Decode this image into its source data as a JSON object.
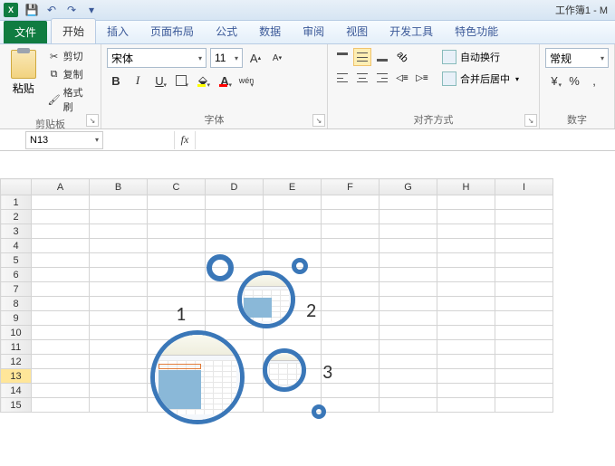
{
  "app": {
    "title": "工作簿1 - M",
    "excel_badge": "X"
  },
  "qat": {
    "save": "💾",
    "undo": "↶",
    "redo": "↷"
  },
  "tabs": {
    "file": "文件",
    "items": [
      "开始",
      "插入",
      "页面布局",
      "公式",
      "数据",
      "审阅",
      "视图",
      "开发工具",
      "特色功能"
    ],
    "active": 0
  },
  "ribbon": {
    "clipboard": {
      "label": "剪贴板",
      "paste": "粘贴",
      "cut": "剪切",
      "copy": "复制",
      "format_painter": "格式刷"
    },
    "font": {
      "label": "字体",
      "name": "宋体",
      "size": "11",
      "bold": "B",
      "italic": "I",
      "underline": "U",
      "grow": "A",
      "shrink": "A",
      "wen": "wén"
    },
    "alignment": {
      "label": "对齐方式",
      "wrap": "自动换行",
      "merge": "合并后居中"
    },
    "number": {
      "label": "数字",
      "format": "常规",
      "percent": "%",
      "comma": ","
    }
  },
  "namebox": "N13",
  "columns": [
    "A",
    "B",
    "C",
    "D",
    "E",
    "F",
    "G",
    "H",
    "I"
  ],
  "rows": [
    "1",
    "2",
    "3",
    "4",
    "5",
    "6",
    "7",
    "8",
    "9",
    "10",
    "11",
    "12",
    "13",
    "14",
    "15"
  ],
  "selected_row": "13",
  "bubbles": {
    "l1": "1",
    "l2": "2",
    "l3": "3"
  }
}
